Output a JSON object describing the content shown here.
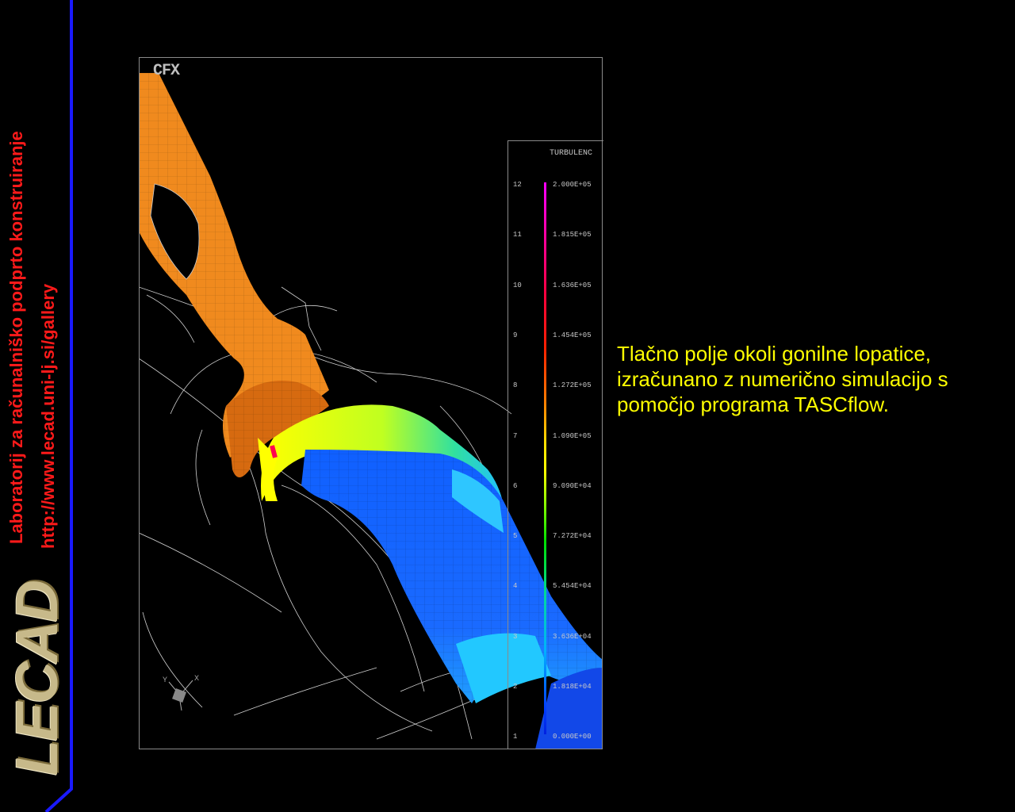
{
  "sidebar": {
    "lab_title": "Laboratorij za računalniško podprto konstruiranje",
    "url": "http://www.lecad.uni-lj.si/gallery",
    "logo": "LECAD",
    "line_color": "#1a1aff"
  },
  "panel": {
    "cfx_label": "CFX",
    "legend_title": "TURBULENC",
    "legend": [
      {
        "num": "12",
        "val": "2.000E+05"
      },
      {
        "num": "11",
        "val": "1.815E+05"
      },
      {
        "num": "10",
        "val": "1.636E+05"
      },
      {
        "num": "9",
        "val": "1.454E+05"
      },
      {
        "num": "8",
        "val": "1.272E+05"
      },
      {
        "num": "7",
        "val": "1.090E+05"
      },
      {
        "num": "6",
        "val": "9.090E+04"
      },
      {
        "num": "5",
        "val": "7.272E+04"
      },
      {
        "num": "4",
        "val": "5.454E+04"
      },
      {
        "num": "3",
        "val": "3.636E+04"
      },
      {
        "num": "2",
        "val": "1.818E+04"
      },
      {
        "num": "1",
        "val": "0.000E+00"
      }
    ]
  },
  "caption": {
    "line1": "Tlačno polje okoli gonilne lopatice,",
    "line2": "izračunano z numerično simulacijo s",
    "line3": "pomočjo programa TASCflow."
  },
  "colors": {
    "caption": "#ffff00",
    "sidebar_text": "#ff1a1a",
    "background": "#000000"
  }
}
